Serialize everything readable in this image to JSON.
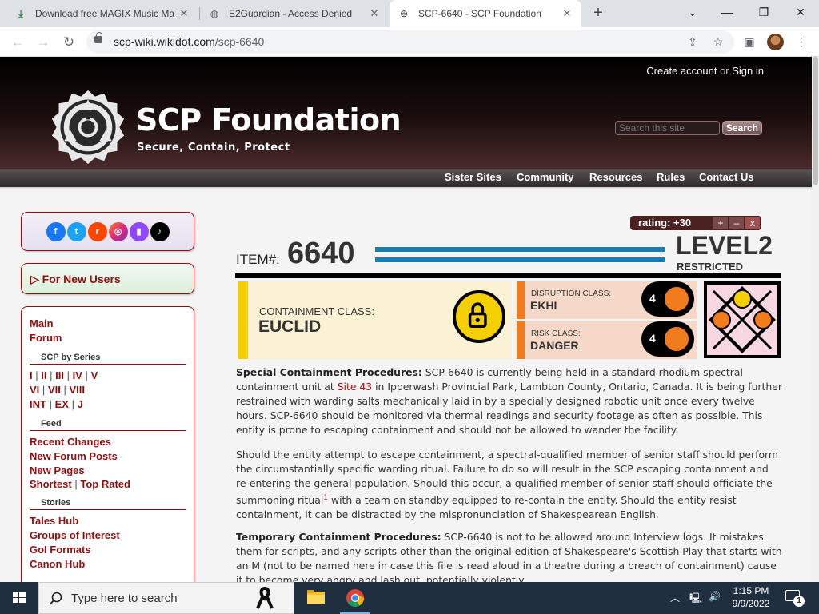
{
  "browser": {
    "tabs": [
      {
        "title": "Download free MAGIX Music Ma",
        "active": false
      },
      {
        "title": "E2Guardian - Access Denied",
        "active": false
      },
      {
        "title": "SCP-6640 - SCP Foundation",
        "active": true
      }
    ],
    "url_host": "scp-wiki.wikidot.com",
    "url_path": "/scp-6640"
  },
  "site": {
    "login_create": "Create account",
    "login_or": "or",
    "login_signin": "Sign in",
    "title": "SCP Foundation",
    "subtitle": "Secure, Contain, Protect",
    "search_placeholder": "Search this site",
    "search_button": "Search",
    "nav": [
      "Sister Sites",
      "Community",
      "Resources",
      "Rules",
      "Contact Us"
    ]
  },
  "sidebar": {
    "social_icons": [
      "facebook-icon",
      "twitter-icon",
      "reddit-icon",
      "instagram-icon",
      "twitch-icon",
      "tiktok-icon"
    ],
    "new_users": "▷ For New Users",
    "main": "Main",
    "forum": "Forum",
    "series_heading": "SCP by Series",
    "series_row1": [
      "I",
      "II",
      "III",
      "IV",
      "V"
    ],
    "series_row2": [
      "VI",
      "VII",
      "VIII"
    ],
    "series_row3": [
      "INT",
      "EX",
      "J"
    ],
    "feed_heading": "Feed",
    "recent_changes": "Recent Changes",
    "new_forum_posts": "New Forum Posts",
    "new_pages": "New Pages",
    "shortest": "Shortest",
    "top_rated": "Top Rated",
    "stories_heading": "Stories",
    "tales_hub": "Tales Hub",
    "goi": "Groups of Interest",
    "goi_formats": "GoI Formats",
    "canon_hub": "Canon Hub"
  },
  "article": {
    "rating_label": "rating: +30",
    "rate_up": "+",
    "rate_down": "–",
    "rate_cancel": "x",
    "item_label": "ITEM#:",
    "item_number": "6640",
    "level": "LEVEL2",
    "clearance": "RESTRICTED",
    "containment_label": "CONTAINMENT CLASS:",
    "containment_value": "EUCLID",
    "disruption_label": "DISRUPTION CLASS:",
    "disruption_value": "EKHI",
    "disruption_level": "4",
    "risk_label": "RISK CLASS:",
    "risk_value": "DANGER",
    "risk_level": "4",
    "p1_head": "Special Containment Procedures:",
    "p1_a": " SCP-6640 is currently being held in a standard rhodium spectral containment unit at ",
    "p1_link": "Site 43",
    "p1_b": " in Ipperwash Provincial Park, Lambton County, Ontario, Canada. It is being further restrained with warding salts mechanically laid in by a specially designed robotic unit once every twelve hours. SCP-6640 should be monitored via thermal readings and security footage as often as possible. This entity is prone to escaping containment and should not be allowed to wander the facility.",
    "p2_a": "Should the entity attempt to escape containment, a spectral-qualified member of senior staff should perform the circumstantially specific warding ritual. Failure to do so will result in the SCP escaping containment and re-entering the general population. Should this occur, a qualified member of senior staff should officiate the summoning ritual",
    "p2_sup": "1",
    "p2_b": " with a team on standby equipped to re-contain the entity. Should the entity resist containment, it can be distracted by the mispronunciation of Shakespearean English.",
    "p3_head": "Temporary Containment Procedures:",
    "p3_a": " SCP-6640 is not to be allowed around Interview logs. It mistakes them for scripts, and any scripts other than the original edition of Shakespeare's Scottish Play that starts with an M (not to be named here in case this file is read aloud in a theatre during a breach of containment) cause it to become very angry and lash out, potentially violently."
  },
  "taskbar": {
    "search_placeholder": "Type here to search",
    "time": "1:15 PM",
    "date": "9/9/2022",
    "notification_count": "1"
  }
}
